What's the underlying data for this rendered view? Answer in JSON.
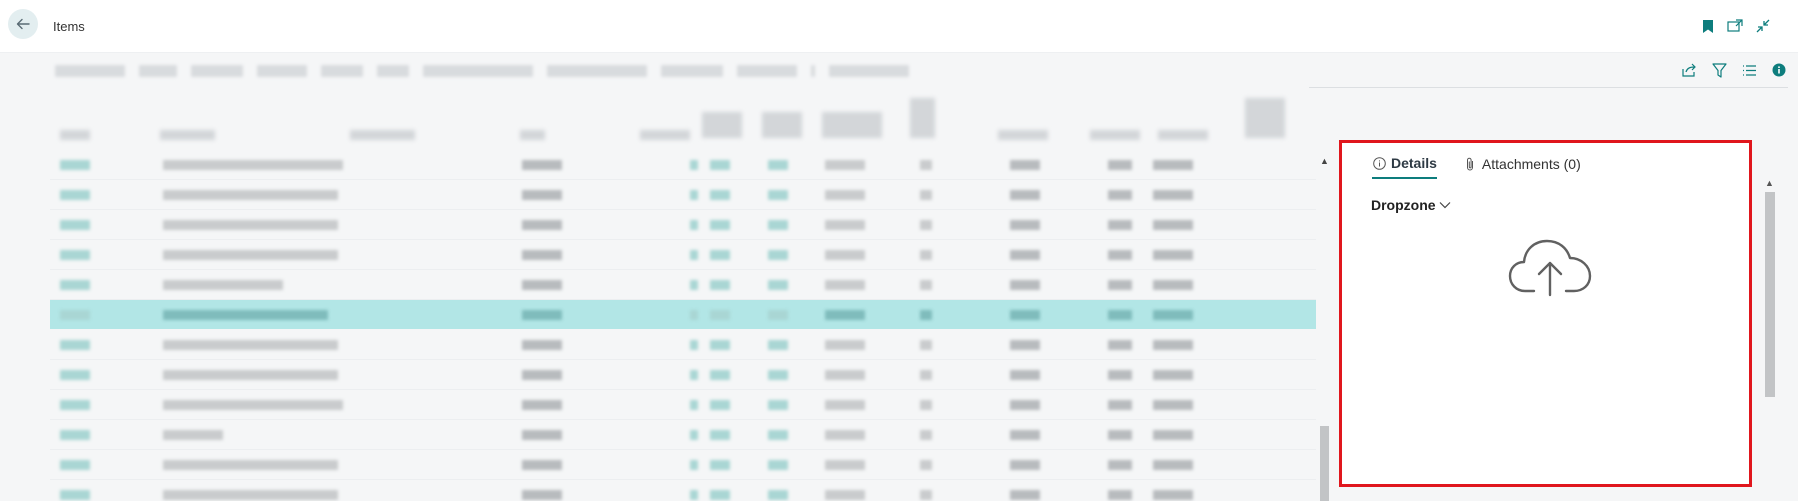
{
  "header": {
    "title": "Items",
    "back_icon": "arrow-left-icon",
    "icons": [
      "bookmark-icon",
      "open-in-new-window-icon",
      "collapse-icon"
    ]
  },
  "toolbar": {
    "right_icons": [
      "share-icon",
      "filter-icon",
      "list-view-icon",
      "info-icon"
    ]
  },
  "list": {
    "selected_row_index": 5,
    "row_count": 12
  },
  "factbox": {
    "tabs": [
      {
        "label": "Details",
        "icon": "info-circle-icon",
        "active": true
      },
      {
        "label": "Attachments (0)",
        "icon": "paperclip-icon",
        "active": false
      }
    ],
    "section": {
      "label": "Dropzone",
      "icon": "cloud-upload-icon"
    }
  },
  "colors": {
    "accent": "#0d7d7d",
    "selection": "#b2e6e6",
    "highlight_border": "#e0161d"
  }
}
